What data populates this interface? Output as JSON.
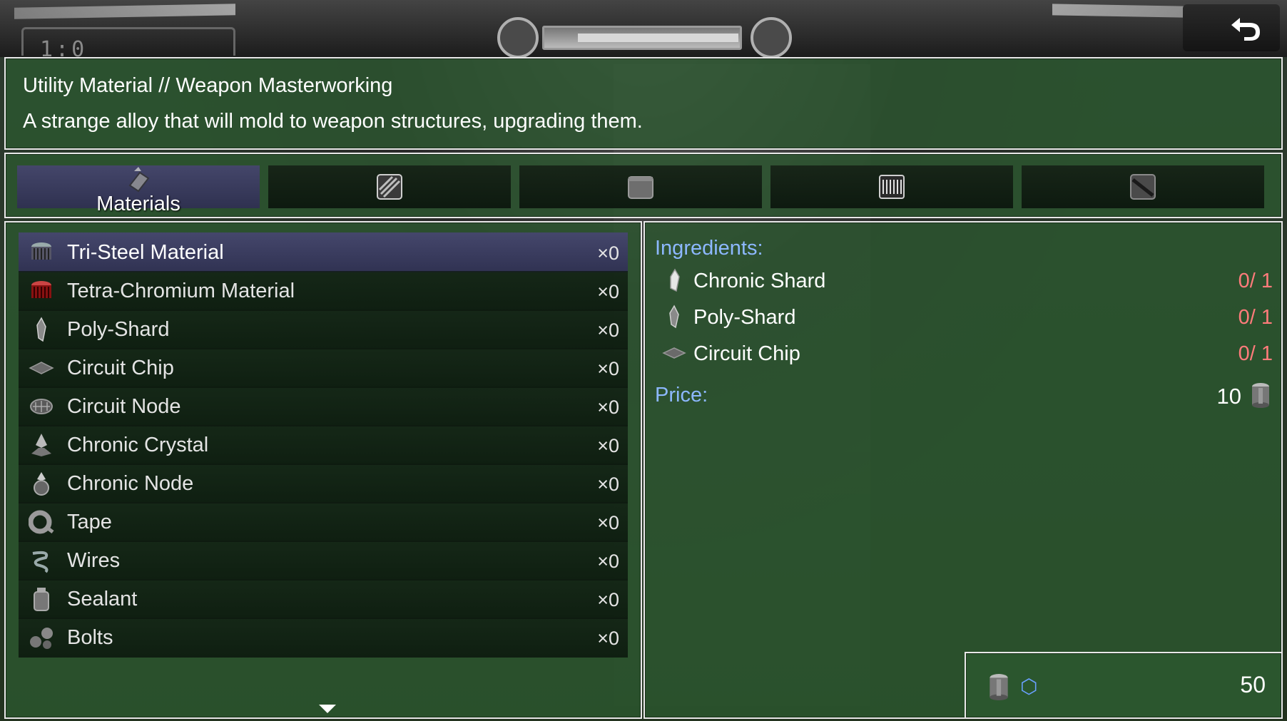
{
  "help": {
    "title": "Utility Material // Weapon Masterworking",
    "description": "A strange alloy that will mold to weapon structures, upgrading them."
  },
  "hud": {
    "time_readout": "1:0"
  },
  "tabs": [
    {
      "label": "Materials",
      "icon": "materials-icon",
      "active": true
    },
    {
      "label": "",
      "icon": "striped-crate-icon",
      "active": false
    },
    {
      "label": "",
      "icon": "grey-block-icon",
      "active": false
    },
    {
      "label": "",
      "icon": "book-icon",
      "active": false
    },
    {
      "label": "",
      "icon": "blade-icon",
      "active": false
    }
  ],
  "items": [
    {
      "name": "Tri-Steel Material",
      "count": "×0",
      "icon": "tri-steel-icon",
      "selected": true
    },
    {
      "name": "Tetra-Chromium Material",
      "count": "×0",
      "icon": "tetra-chromium-icon"
    },
    {
      "name": "Poly-Shard",
      "count": "×0",
      "icon": "poly-shard-icon"
    },
    {
      "name": "Circuit Chip",
      "count": "×0",
      "icon": "circuit-chip-icon"
    },
    {
      "name": "Circuit Node",
      "count": "×0",
      "icon": "circuit-node-icon"
    },
    {
      "name": "Chronic Crystal",
      "count": "×0",
      "icon": "chronic-crystal-icon"
    },
    {
      "name": "Chronic Node",
      "count": "×0",
      "icon": "chronic-node-icon"
    },
    {
      "name": "Tape",
      "count": "×0",
      "icon": "tape-icon"
    },
    {
      "name": "Wires",
      "count": "×0",
      "icon": "wires-icon"
    },
    {
      "name": "Sealant",
      "count": "×0",
      "icon": "sealant-icon"
    },
    {
      "name": "Bolts",
      "count": "×0",
      "icon": "bolts-icon"
    }
  ],
  "detail": {
    "ingredients_label": "Ingredients:",
    "ingredients": [
      {
        "name": "Chronic Shard",
        "qty": "0/ 1",
        "icon": "chronic-shard-icon"
      },
      {
        "name": "Poly-Shard",
        "qty": "0/ 1",
        "icon": "poly-shard-icon"
      },
      {
        "name": "Circuit Chip",
        "qty": "0/ 1",
        "icon": "circuit-chip-icon"
      }
    ],
    "price_label": "Price:",
    "price_value": "10"
  },
  "currency": {
    "amount": "50",
    "symbol": "⬡"
  },
  "colors": {
    "panel_green": "#2c5830",
    "selected_row": "#45476c",
    "heading_blue": "#8db8ff",
    "missing_red": "#ff7b7b"
  }
}
